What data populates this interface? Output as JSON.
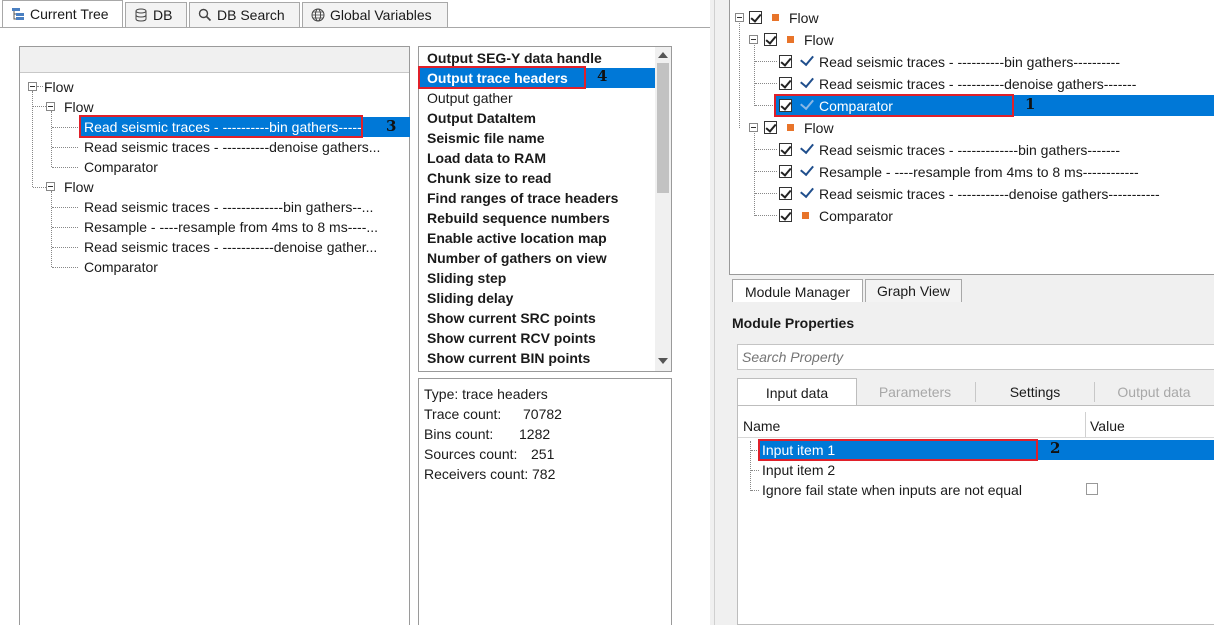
{
  "tabs": [
    {
      "label": "Current Tree",
      "icon": "tree-icon",
      "active": true
    },
    {
      "label": "DB",
      "icon": "database-icon",
      "active": false
    },
    {
      "label": "DB Search",
      "icon": "magnifier-icon",
      "active": false
    },
    {
      "label": "Global Variables",
      "icon": "globe-icon",
      "active": false
    }
  ],
  "left_tree": {
    "root": "Flow",
    "flow1": {
      "label": "Flow",
      "items": [
        "Read seismic traces - ----------bin gathers-----",
        "Read seismic traces - ----------denoise gathers...",
        "Comparator"
      ]
    },
    "flow2": {
      "label": "Flow",
      "items": [
        "Read seismic traces - -------------bin gathers--...",
        "Resample - ----resample from 4ms to 8 ms----...",
        "Read seismic traces - -----------denoise gather...",
        "Comparator"
      ]
    }
  },
  "outputs": {
    "items": [
      {
        "label": "Output SEG-Y data handle",
        "bold": true
      },
      {
        "label": "Output trace headers",
        "bold": true,
        "selected": true
      },
      {
        "label": "Output gather",
        "bold": false
      },
      {
        "label": "Output DataItem",
        "bold": true
      },
      {
        "label": "Seismic file name",
        "bold": true
      },
      {
        "label": "Load data to RAM",
        "bold": true
      },
      {
        "label": "Chunk size to read",
        "bold": true
      },
      {
        "label": "Find ranges of trace headers",
        "bold": true
      },
      {
        "label": "Rebuild sequence numbers",
        "bold": true
      },
      {
        "label": "Enable active location map",
        "bold": true
      },
      {
        "label": "Number of gathers on view",
        "bold": true
      },
      {
        "label": "Sliding step",
        "bold": true
      },
      {
        "label": "Sliding delay",
        "bold": true
      },
      {
        "label": "Show current SRC points",
        "bold": true
      },
      {
        "label": "Show current RCV points",
        "bold": true
      },
      {
        "label": "Show current BIN points",
        "bold": true
      }
    ]
  },
  "info": {
    "type": "Type: trace headers",
    "lines": [
      {
        "label": "Trace count:",
        "value": "70782"
      },
      {
        "label": "Bins count:",
        "value": "1282"
      },
      {
        "label": "Sources count:",
        "value": "251"
      },
      {
        "label": "Receivers count:",
        "value": "782"
      }
    ]
  },
  "right_tree": {
    "root": "Flow",
    "flow1": {
      "label": "Flow",
      "items": [
        "Read seismic traces - ----------bin gathers----------",
        "Read seismic traces - ----------denoise gathers-------",
        "Comparator"
      ]
    },
    "flow2": {
      "label": "Flow",
      "items": [
        "Read seismic traces - -------------bin gathers-------",
        "Resample - ----resample from 4ms to 8 ms------------",
        "Read seismic traces - -----------denoise gathers-----------",
        "Comparator"
      ]
    }
  },
  "bottom_tabs": {
    "module_manager": "Module Manager",
    "graph_view": "Graph View"
  },
  "module_properties": {
    "title": "Module Properties",
    "search_placeholder": "Search Property",
    "tabs": [
      "Input data",
      "Parameters",
      "Settings",
      "Output data"
    ],
    "columns": {
      "name": "Name",
      "value": "Value"
    },
    "rows": [
      "Input item 1",
      "Input item 2",
      "Ignore fail state when inputs are not equal"
    ]
  },
  "annotations": {
    "n1": "1",
    "n2": "2",
    "n3": "3",
    "n4": "4"
  },
  "colors": {
    "selection": "#0078d7",
    "annotation": "#e0202a",
    "flow_marker": "#e8742a"
  }
}
